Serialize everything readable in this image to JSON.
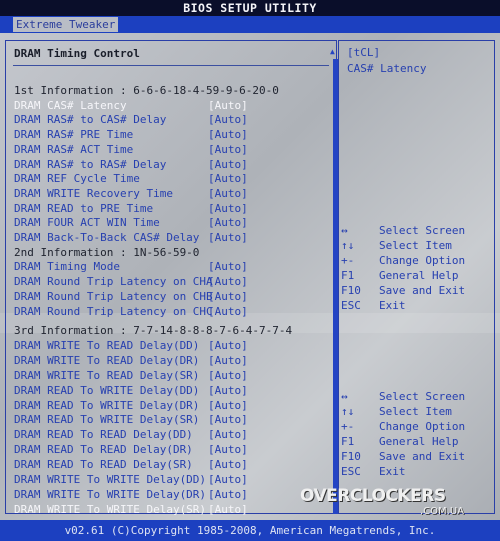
{
  "title": "BIOS SETUP UTILITY",
  "tab": "Extreme Tweaker",
  "section_title": "DRAM Timing Control",
  "rows": [
    {
      "type": "info",
      "label": "1st Information : 6-6-6-18-4-59-9-6-20-0"
    },
    {
      "type": "item",
      "label": "DRAM CAS# Latency",
      "value": "[Auto]",
      "selected": true
    },
    {
      "type": "item",
      "label": "DRAM RAS# to CAS# Delay",
      "value": "[Auto]"
    },
    {
      "type": "item",
      "label": "DRAM RAS# PRE Time",
      "value": "[Auto]"
    },
    {
      "type": "item",
      "label": "DRAM RAS# ACT Time",
      "value": "[Auto]"
    },
    {
      "type": "item",
      "label": "DRAM RAS# to RAS# Delay",
      "value": "[Auto]"
    },
    {
      "type": "item",
      "label": "DRAM REF Cycle Time",
      "value": "[Auto]"
    },
    {
      "type": "item",
      "label": "DRAM WRITE Recovery Time",
      "value": "[Auto]"
    },
    {
      "type": "item",
      "label": "DRAM READ to PRE Time",
      "value": "[Auto]"
    },
    {
      "type": "item",
      "label": "DRAM FOUR ACT WIN Time",
      "value": "[Auto]"
    },
    {
      "type": "item",
      "label": "DRAM Back-To-Back CAS# Delay",
      "value": "[Auto]"
    },
    {
      "type": "info",
      "label": "2nd Information : 1N-56-59-0"
    },
    {
      "type": "item",
      "label": "DRAM Timing Mode",
      "value": "[Auto]"
    },
    {
      "type": "item",
      "label": "DRAM Round Trip Latency on CHA",
      "value": "[Auto]"
    },
    {
      "type": "item",
      "label": "DRAM Round Trip Latency on CHB",
      "value": "[Auto]"
    },
    {
      "type": "item",
      "label": "DRAM Round Trip Latency on CHC",
      "value": "[Auto]"
    },
    {
      "type": "info",
      "label": "3rd Information : 7-7-14-8-8-8-7-6-4-7-7-4"
    },
    {
      "type": "item",
      "label": "DRAM WRITE To READ Delay(DD)",
      "value": "[Auto]"
    },
    {
      "type": "item",
      "label": "DRAM WRITE To READ Delay(DR)",
      "value": "[Auto]"
    },
    {
      "type": "item",
      "label": "DRAM WRITE To READ Delay(SR)",
      "value": "[Auto]"
    },
    {
      "type": "item",
      "label": "DRAM READ To WRITE Delay(DD)",
      "value": "[Auto]"
    },
    {
      "type": "item",
      "label": "DRAM READ To WRITE Delay(DR)",
      "value": "[Auto]"
    },
    {
      "type": "item",
      "label": "DRAM READ To WRITE Delay(SR)",
      "value": "[Auto]"
    },
    {
      "type": "item",
      "label": "DRAM READ To READ Delay(DD)",
      "value": "[Auto]"
    },
    {
      "type": "item",
      "label": "DRAM READ To READ Delay(DR)",
      "value": "[Auto]"
    },
    {
      "type": "item",
      "label": "DRAM READ To READ Delay(SR)",
      "value": "[Auto]"
    },
    {
      "type": "item",
      "label": "DRAM WRITE To WRITE Delay(DD)",
      "value": "[Auto]"
    },
    {
      "type": "item",
      "label": "DRAM WRITE To WRITE Delay(DR)",
      "value": "[Auto]"
    },
    {
      "type": "item",
      "label": "DRAM WRITE To WRITE Delay(SR)",
      "value": "[Auto]",
      "selected": true
    }
  ],
  "help": {
    "line1": "[tCL]",
    "line2": "CAS# Latency"
  },
  "keys": [
    {
      "key": "↔",
      "label": "Select Screen"
    },
    {
      "key": "↑↓",
      "label": "Select Item"
    },
    {
      "key": "+-",
      "label": "Change Option"
    },
    {
      "key": "F1",
      "label": "General Help"
    },
    {
      "key": "F10",
      "label": "Save and Exit"
    },
    {
      "key": "ESC",
      "label": "Exit"
    }
  ],
  "watermark": "OVERCLOCKERS",
  "watermark_domain": ".COM.UA",
  "footer": "v02.61 (C)Copyright 1985-2008, American Megatrends, Inc."
}
